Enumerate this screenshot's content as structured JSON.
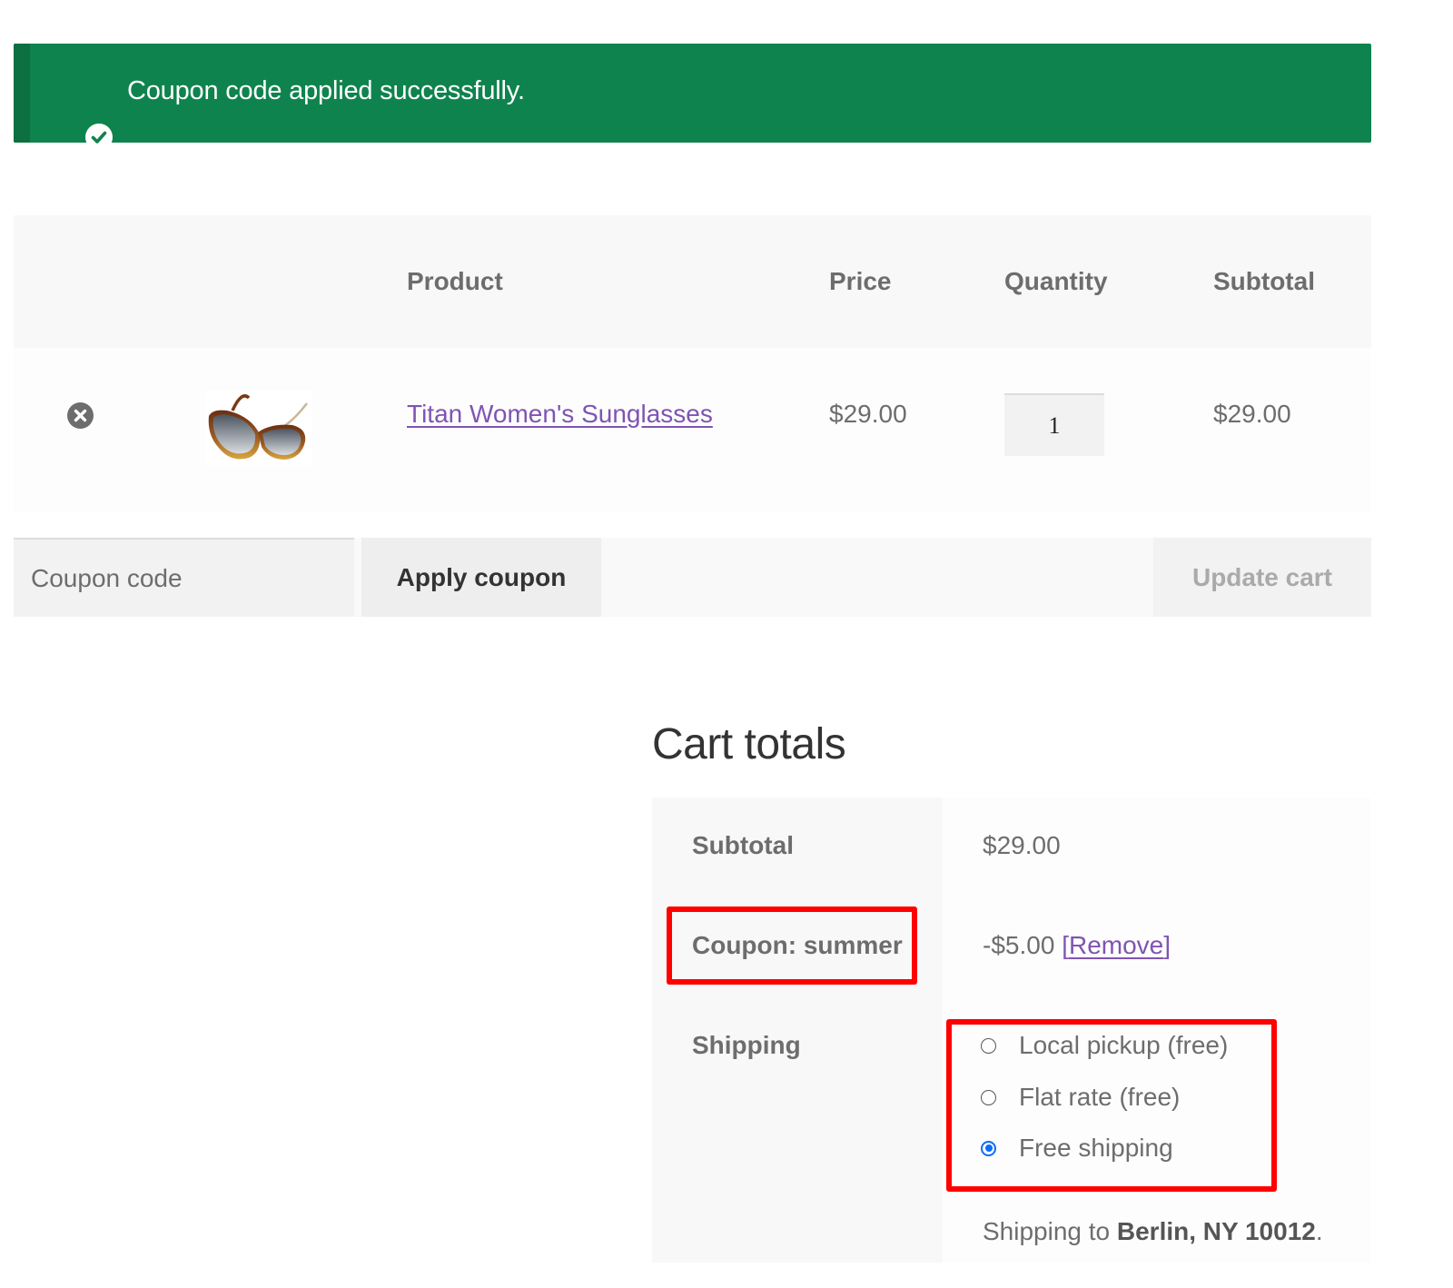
{
  "notice": {
    "icon": "check-circle-icon",
    "message": "Coupon code applied successfully.",
    "color": "#0f834d"
  },
  "cart_table": {
    "headers": {
      "product": "Product",
      "price": "Price",
      "quantity": "Quantity",
      "subtotal": "Subtotal"
    },
    "rows": [
      {
        "remove_icon": "remove-circle-icon",
        "thumbnail": "sunglasses-image",
        "product_name": "Titan Women's Sunglasses",
        "price": "$29.00",
        "quantity": "1",
        "subtotal": "$29.00"
      }
    ]
  },
  "actions": {
    "coupon_placeholder": "Coupon code",
    "coupon_value": "",
    "apply_label": "Apply coupon",
    "update_label": "Update cart"
  },
  "totals": {
    "title": "Cart totals",
    "subtotal_label": "Subtotal",
    "subtotal_value": "$29.00",
    "coupon_label": "Coupon: summer",
    "coupon_discount": "-$5.00",
    "coupon_remove_open": "[",
    "coupon_remove_label": "Remove",
    "coupon_remove_close": "]",
    "shipping_label": "Shipping",
    "shipping_options": [
      {
        "label": "Local pickup (free)",
        "checked": false
      },
      {
        "label": "Flat rate (free)",
        "checked": false
      },
      {
        "label": "Free shipping",
        "checked": true
      }
    ],
    "shipping_to_prefix": "Shipping to ",
    "shipping_to_location": "Berlin, NY 10012",
    "shipping_to_suffix": "."
  },
  "colors": {
    "link": "#7f54b3",
    "highlight": "#ff0000",
    "radio_selected": "#0a6ef5"
  }
}
